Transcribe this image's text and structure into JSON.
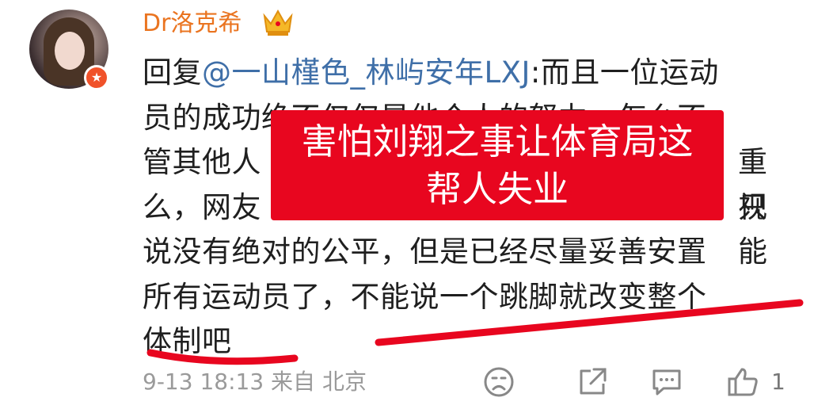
{
  "post": {
    "username": "Dr洛克希",
    "reply_prefix": "回复",
    "mention": "@一山槿色_林屿安年LXJ",
    "text_line1_tail": ":而且一位运动",
    "text_lines": [
      "员的成功绝不仅仅是他个人的努力，怎么不",
      "管其他人",
      "么，网友",
      "说没有绝对的公平，但是已经尽量妥善安置",
      "所有运动员了，不能说一个跳脚就改变整个",
      "体制吧"
    ],
    "partially_hidden_fragments": [
      "重视",
      "只能"
    ]
  },
  "overlay": {
    "line1": "害怕刘翔之事让体育局这",
    "line2": "帮人失业",
    "color": "#e8061f"
  },
  "meta": {
    "time": "9-13 18:13",
    "source": "来自 北京"
  },
  "actions": {
    "emoji_icon": "sad-face-icon",
    "share_icon": "share-icon",
    "comment_icon": "comment-icon",
    "like_icon": "thumbs-up-icon",
    "like_count": "1"
  },
  "colors": {
    "username": "#ea7420",
    "mention": "#3f6fa8",
    "underline": "#e8061f"
  }
}
